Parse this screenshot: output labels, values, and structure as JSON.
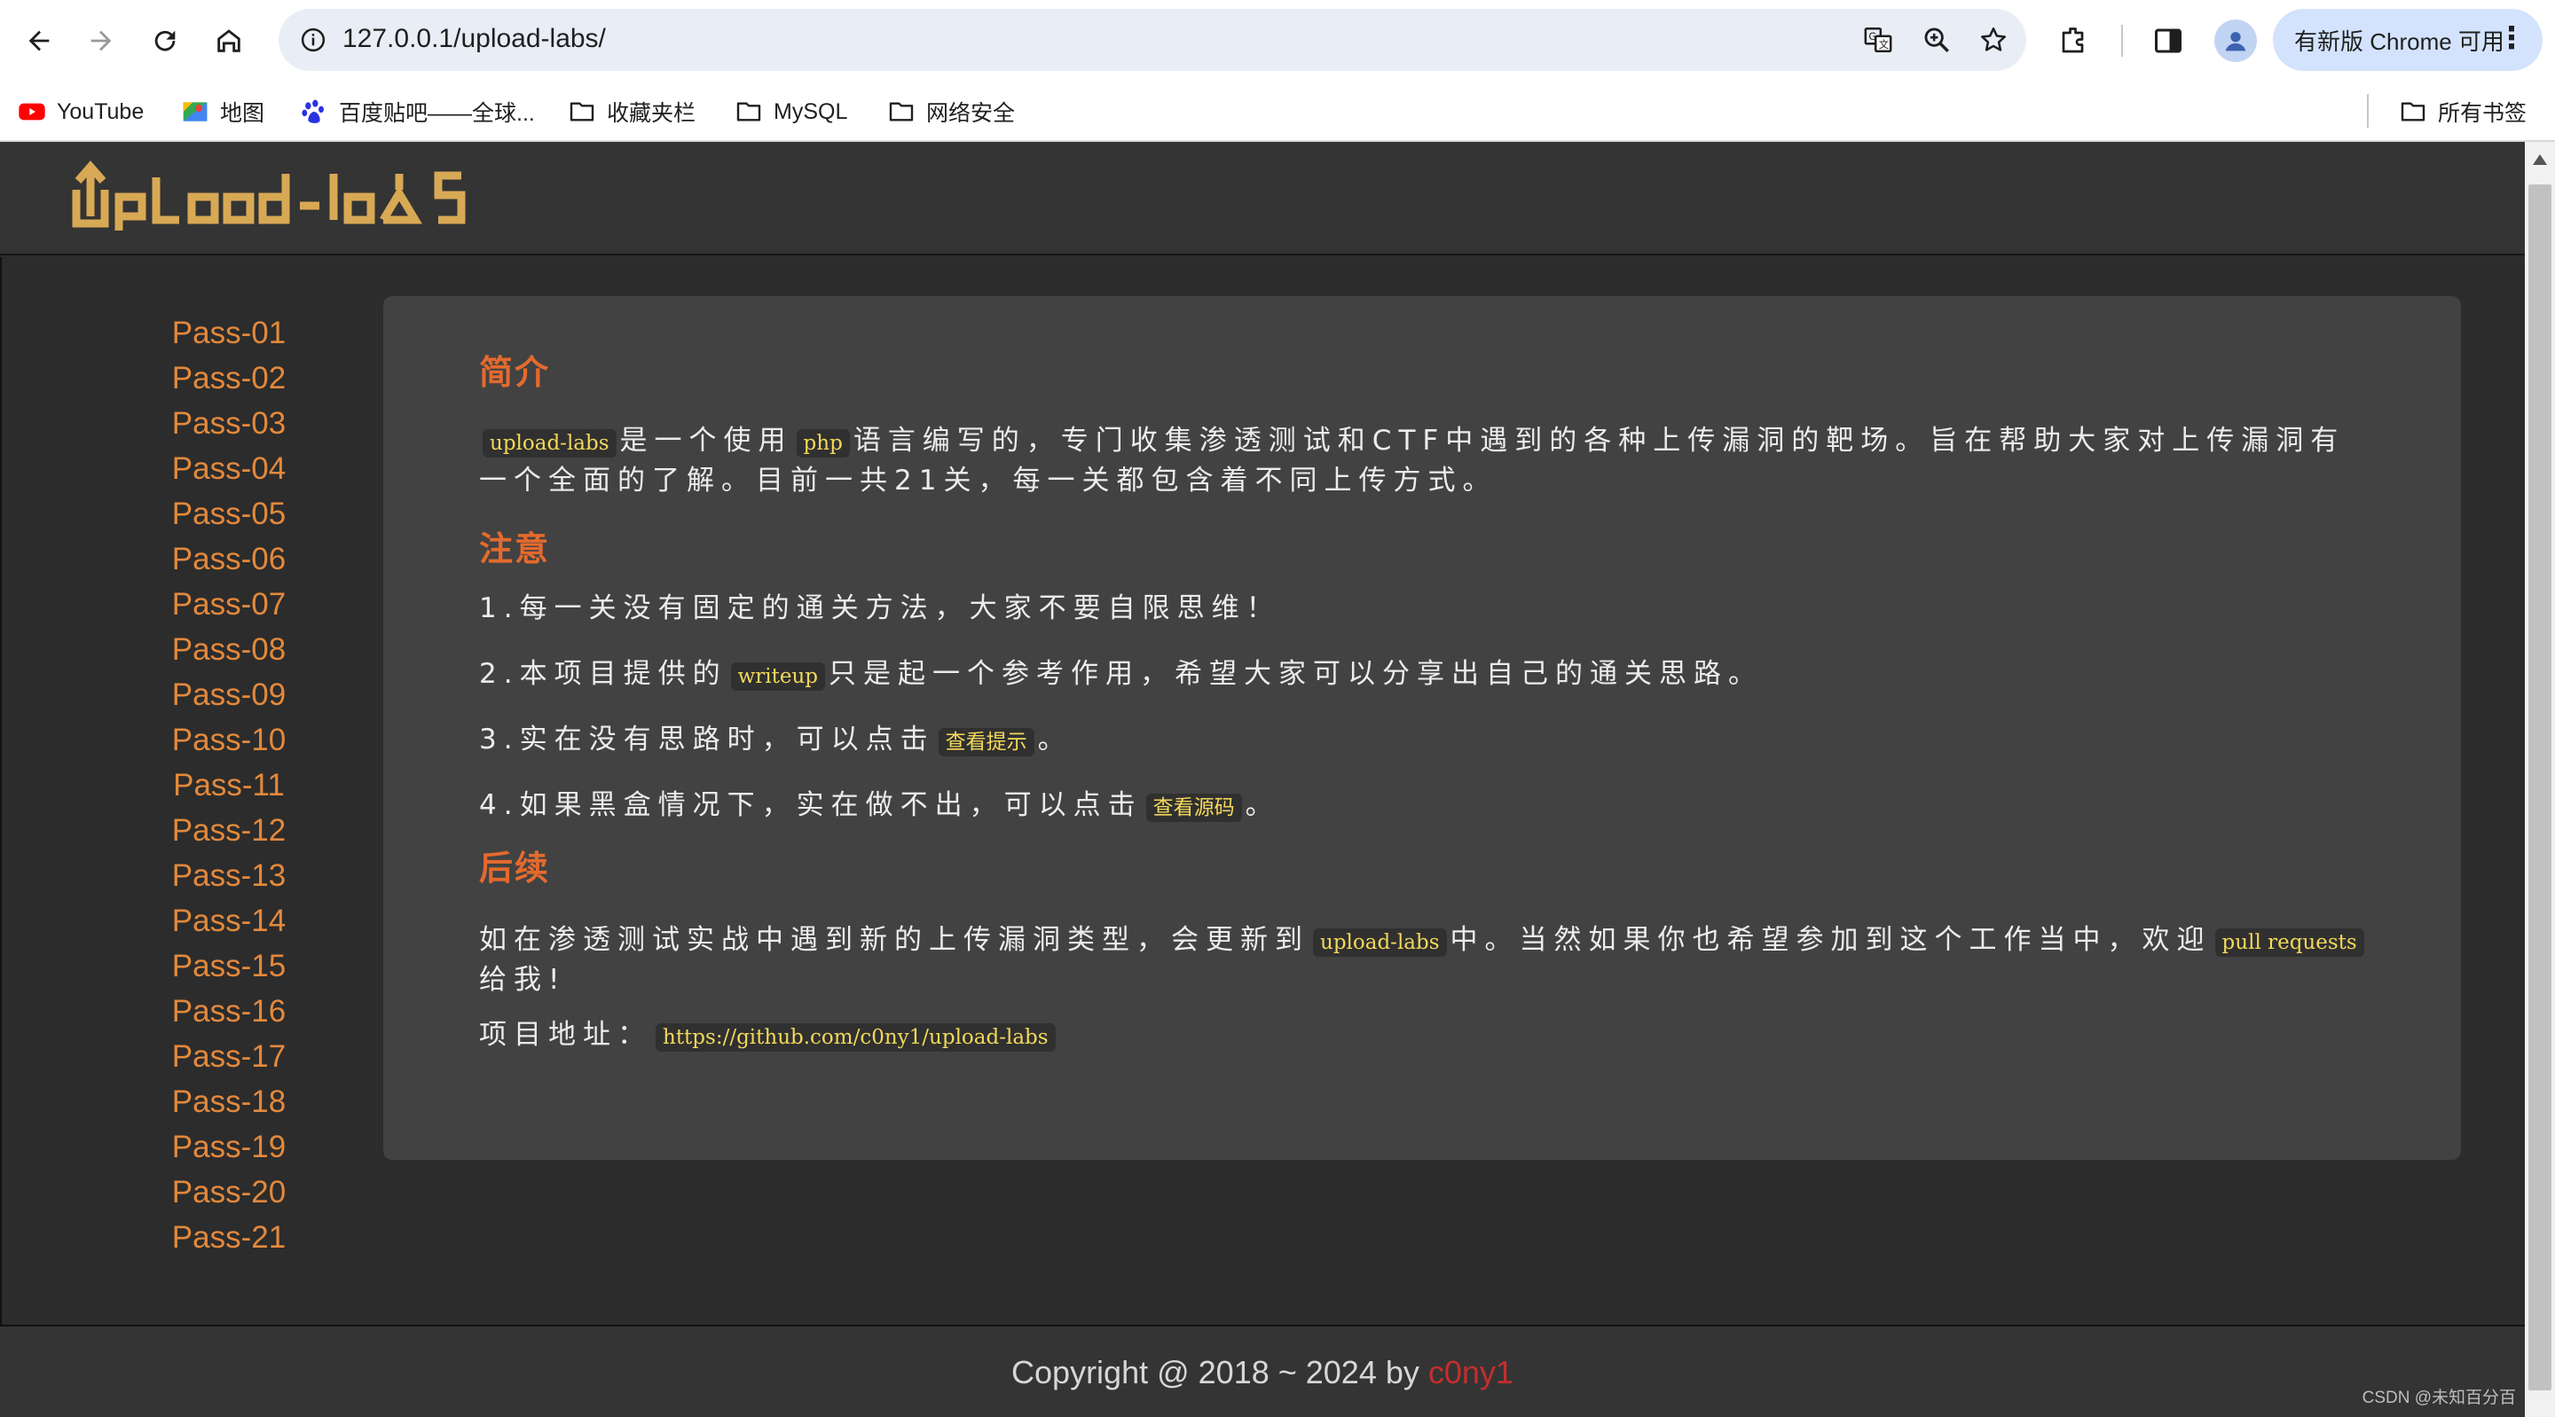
{
  "browser": {
    "url": "127.0.0.1/upload-labs/",
    "update_label": "有新版 Chrome 可用",
    "bookmarks": [
      "YouTube",
      "地图",
      "百度贴吧——全球...",
      "收藏夹栏",
      "MySQL",
      "网络安全"
    ],
    "all_bookmarks": "所有书签"
  },
  "site": {
    "logo": "upload-labs",
    "passes": [
      "Pass-01",
      "Pass-02",
      "Pass-03",
      "Pass-04",
      "Pass-05",
      "Pass-06",
      "Pass-07",
      "Pass-08",
      "Pass-09",
      "Pass-10",
      "Pass-11",
      "Pass-12",
      "Pass-13",
      "Pass-14",
      "Pass-15",
      "Pass-16",
      "Pass-17",
      "Pass-18",
      "Pass-19",
      "Pass-20",
      "Pass-21"
    ],
    "intro": {
      "title": "简介",
      "code1": "upload-labs",
      "t1": "是一个使用",
      "code2": "php",
      "t2": "语言编写的，专门收集渗透测试和CTF中遇到的各种上传漏洞的靶场。旨在帮助大家对上传漏洞有一个全面的了解。目前一共21关，每一关都包含着不同上传方式。"
    },
    "notes": {
      "title": "注意",
      "n1": "1.每一关没有固定的通关方法，大家不要自限思维！",
      "n2a": "2.本项目提供的",
      "n2code": "writeup",
      "n2b": "只是起一个参考作用，希望大家可以分享出自己的通关思路。",
      "n3a": "3.实在没有思路时，可以点击",
      "n3code": "查看提示",
      "n3b": "。",
      "n4a": "4.如果黑盒情况下，实在做不出，可以点击",
      "n4code": "查看源码",
      "n4b": "。"
    },
    "followup": {
      "title": "后续",
      "t1": "如在渗透测试实战中遇到新的上传漏洞类型，会更新到",
      "code1": "upload-labs",
      "t2": "中。当然如果你也希望参加到这个工作当中，欢迎",
      "code2": "pull requests",
      "t3": "给我!",
      "addr_label": "项目地址：",
      "addr": "https://github.com/c0ny1/upload-labs"
    },
    "footer": {
      "text": "Copyright @ 2018 ~ 2024 by ",
      "author": "c0ny1"
    }
  },
  "watermark": "CSDN @未知百分百"
}
